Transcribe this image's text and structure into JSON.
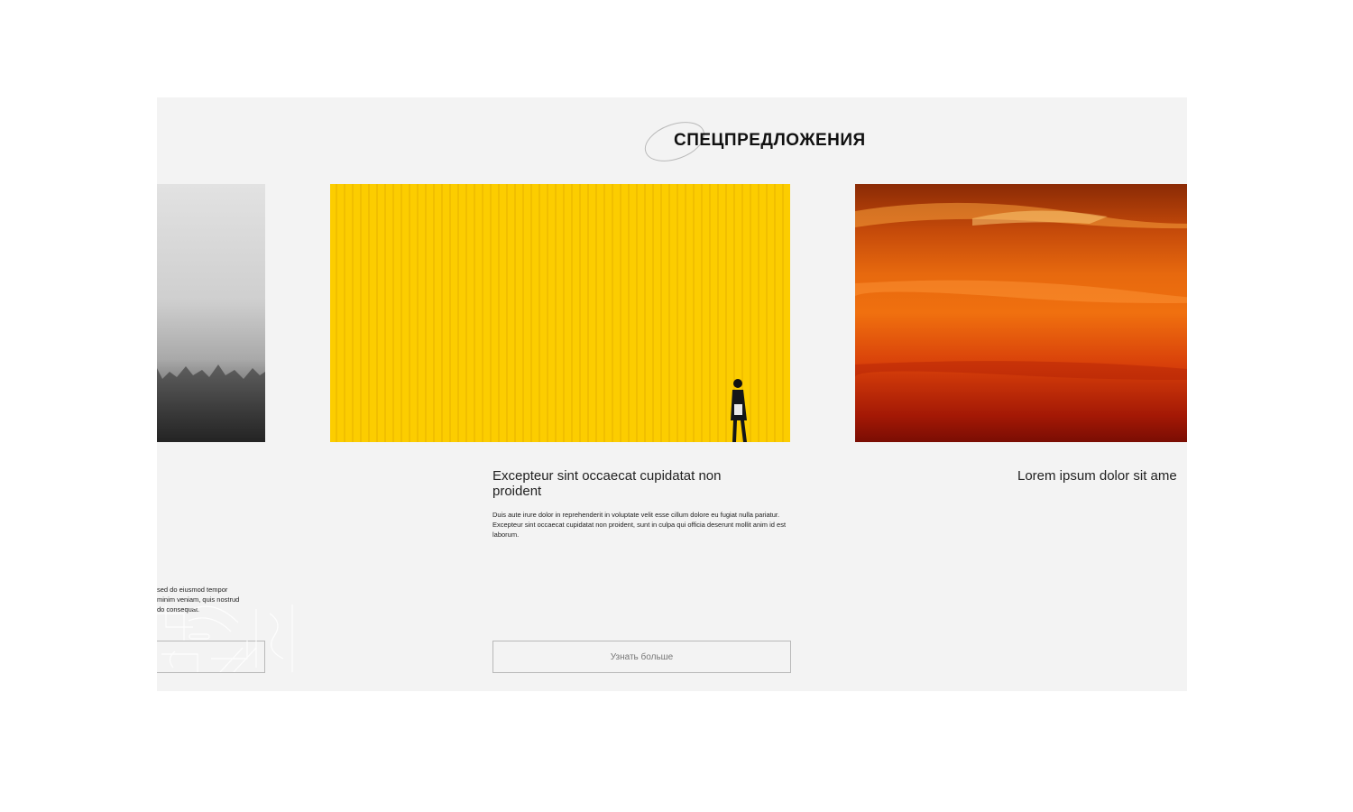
{
  "section": {
    "title": "СПЕЦПРЕДЛОЖЕНИЯ"
  },
  "cards": [
    {
      "image": "misty-forest-photo",
      "title": "",
      "text": "sed do eiusmod tempor\nminim veniam, quis nostrud\ndo consequat.",
      "button_label": ""
    },
    {
      "image": "yellow-wall-photo",
      "title": "Excepteur sint occaecat cupidatat non proident",
      "text": "Duis aute irure dolor in reprehenderit in voluptate velit esse cillum dolore eu fugiat nulla pariatur. Excepteur sint occaecat cupidatat non proident, sunt in culpa qui officia deserunt mollit anim id est laborum.",
      "button_label": "Узнать больше"
    },
    {
      "image": "orange-sunset-sky-photo",
      "title": "Lorem ipsum dolor sit ame",
      "text": "",
      "button_label": ""
    }
  ],
  "icons": {
    "title_decoration": "ellipse-outline-icon",
    "pattern": "decorative-line-pattern"
  },
  "colors": {
    "section_background": "#f3f3f3",
    "yellow_accent": "#fccd00",
    "button_border": "#b8b8b8"
  }
}
